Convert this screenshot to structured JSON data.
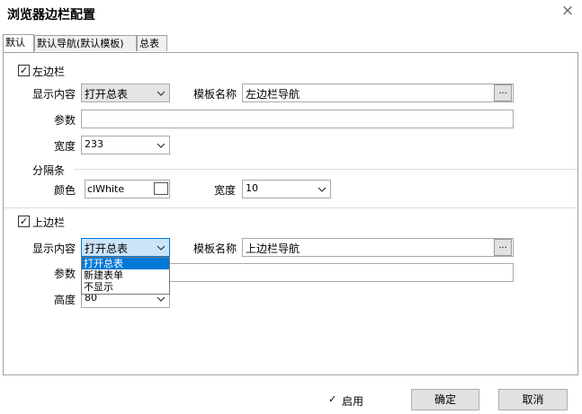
{
  "window": {
    "title": "浏览器边栏配置",
    "close_icon": "×"
  },
  "tabs": [
    {
      "label": "默认"
    },
    {
      "label": "默认导航(默认模板)"
    },
    {
      "label": "总表"
    }
  ],
  "left_bar": {
    "checkbox_label": "左边栏",
    "checked": true,
    "content_label": "显示内容",
    "content_value": "打开总表",
    "template_label": "模板名称",
    "template_value": "左边栏导航",
    "browse_label": "...",
    "params_label": "参数",
    "params_value": "",
    "width_label": "宽度",
    "width_value": "233"
  },
  "separator": {
    "section_label": "分隔条",
    "color_label": "颜色",
    "color_value": "clWhite",
    "width_label": "宽度",
    "width_value": "10"
  },
  "top_bar": {
    "checkbox_label": "上边栏",
    "checked": true,
    "content_label": "显示内容",
    "content_value": "打开总表",
    "template_label": "模板名称",
    "template_value": "上边栏导航",
    "browse_label": "...",
    "params_label": "参数",
    "params_value": "",
    "height_label": "高度",
    "height_value": "80",
    "dropdown_options": [
      "打开总表",
      "新建表单",
      "不显示"
    ]
  },
  "footer": {
    "enable_label": "启用",
    "enable_checked": true,
    "ok_label": "确定",
    "cancel_label": "取消"
  },
  "colors": {
    "selection": "#0078d7",
    "focus_bg": "#cce4f7"
  }
}
